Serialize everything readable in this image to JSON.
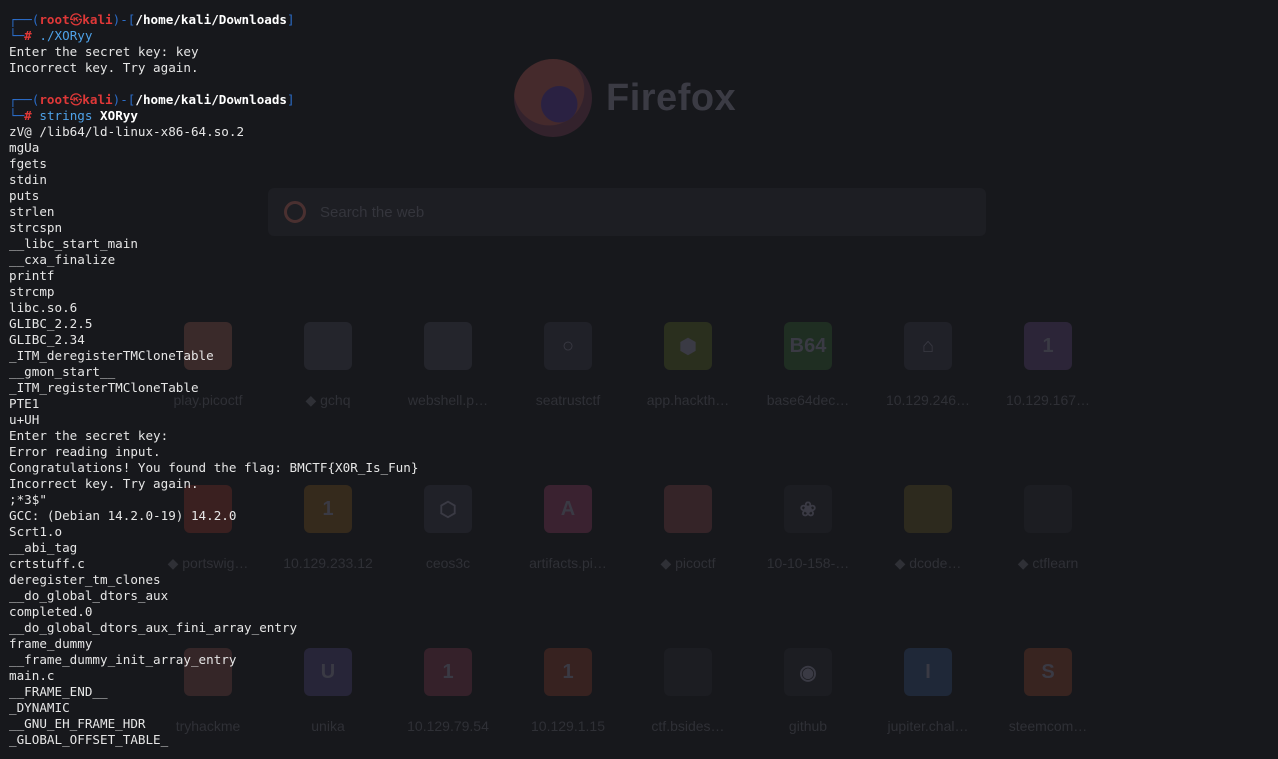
{
  "browser_bg": {
    "wordmark": "Firefox",
    "search_placeholder": "Search the web",
    "tiles": [
      {
        "label": "play.picoctf",
        "glyph": "",
        "color": "#3a2a2a"
      },
      {
        "label": "◆ gchq",
        "glyph": "",
        "color": "#24252c"
      },
      {
        "label": "webshell.p…",
        "glyph": "",
        "color": "#24252c"
      },
      {
        "label": "seatrustctf",
        "glyph": "○",
        "color": "#202128"
      },
      {
        "label": "app.hackth…",
        "glyph": "⬢",
        "color": "#2a2f1e"
      },
      {
        "label": "base64dec…",
        "glyph": "B64",
        "color": "#1f2e22"
      },
      {
        "label": "10.129.246…",
        "glyph": "⌂",
        "color": "#202128"
      },
      {
        "label": "10.129.167…",
        "glyph": "1",
        "color": "#2c2538"
      },
      {
        "label": "◆ portswig…",
        "glyph": "",
        "color": "#3a2020"
      },
      {
        "label": "10.129.233.12",
        "glyph": "1",
        "color": "#352a1c"
      },
      {
        "label": "ceos3c",
        "glyph": "⬡",
        "color": "#202128"
      },
      {
        "label": "artifacts.pi…",
        "glyph": "A",
        "color": "#3a2230"
      },
      {
        "label": "◆ picoctf",
        "glyph": "",
        "color": "#352428"
      },
      {
        "label": "10-10-158-…",
        "glyph": "❀",
        "color": "#1c1d22"
      },
      {
        "label": "◆ dcode…",
        "glyph": "",
        "color": "#2d2a1e"
      },
      {
        "label": "◆ ctflearn",
        "glyph": "",
        "color": "#1c1d22"
      },
      {
        "label": "tryhackme",
        "glyph": "",
        "color": "#352628"
      },
      {
        "label": "unika",
        "glyph": "U",
        "color": "#272538"
      },
      {
        "label": "10.129.79.54",
        "glyph": "1",
        "color": "#35212a"
      },
      {
        "label": "10.129.1.15",
        "glyph": "1",
        "color": "#372220"
      },
      {
        "label": "ctf.bsides…",
        "glyph": "",
        "color": "#1c1d22"
      },
      {
        "label": "github",
        "glyph": "◉",
        "color": "#1c1d22"
      },
      {
        "label": "jupiter.chal…",
        "glyph": "I",
        "color": "#1f2838"
      },
      {
        "label": "steemcom…",
        "glyph": "S",
        "color": "#382420"
      }
    ]
  },
  "terminal": {
    "prompt1": {
      "frame_top": "┌──(",
      "user": "root",
      "at": "㉿",
      "host": "kali",
      "sep": ")-[",
      "path": "/home/kali/Downloads",
      "close": "]",
      "frame_bottom": "└─",
      "hash": "#",
      "command": "./XORyy",
      "argument": ""
    },
    "output1": [
      "Enter the secret key: key",
      "Incorrect key. Try again."
    ],
    "prompt2": {
      "frame_top": "┌──(",
      "user": "root",
      "at": "㉿",
      "host": "kali",
      "sep": ")-[",
      "path": "/home/kali/Downloads",
      "close": "]",
      "frame_bottom": "└─",
      "hash": "#",
      "command": "strings",
      "argument": "XORyy"
    },
    "output2": [
      "zV@ /lib64/ld-linux-x86-64.so.2",
      "mgUa",
      "fgets",
      "stdin",
      "puts",
      "strlen",
      "strcspn",
      "__libc_start_main",
      "__cxa_finalize",
      "printf",
      "strcmp",
      "libc.so.6",
      "GLIBC_2.2.5",
      "GLIBC_2.34",
      "_ITM_deregisterTMCloneTable",
      "__gmon_start__",
      "_ITM_registerTMCloneTable",
      "PTE1",
      "u+UH",
      "Enter the secret key:",
      "Error reading input.",
      "Congratulations! You found the flag: BMCTF{X0R_Is_Fun}",
      "Incorrect key. Try again.",
      ";*3$\"",
      "GCC: (Debian 14.2.0-19) 14.2.0",
      "Scrt1.o",
      "__abi_tag",
      "crtstuff.c",
      "deregister_tm_clones",
      "__do_global_dtors_aux",
      "completed.0",
      "__do_global_dtors_aux_fini_array_entry",
      "frame_dummy",
      "__frame_dummy_init_array_entry",
      "main.c",
      "__FRAME_END__",
      "_DYNAMIC",
      "__GNU_EH_FRAME_HDR",
      "_GLOBAL_OFFSET_TABLE_"
    ]
  }
}
